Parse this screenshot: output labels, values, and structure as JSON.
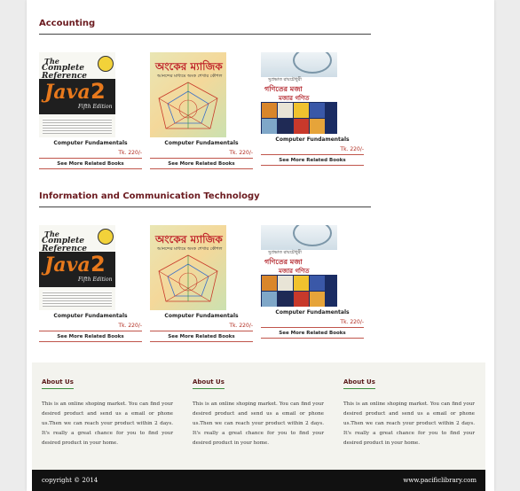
{
  "sections": [
    {
      "title": "Accounting",
      "books": [
        {
          "name": "Computer Fundamentals",
          "price": "Tk. 220/-",
          "more": "See More Related Books",
          "cover": "java"
        },
        {
          "name": "Computer Fundamentals",
          "price": "Tk. 220/-",
          "more": "See More Related Books",
          "cover": "magic"
        },
        {
          "name": "Computer Fundamentals",
          "price": "Tk. 220/-",
          "more": "See More Related Books",
          "cover": "math"
        }
      ]
    },
    {
      "title": "Information and Communication Technology",
      "books": [
        {
          "name": "Computer Fundamentals",
          "price": "Tk. 220/-",
          "more": "See More Related Books",
          "cover": "java"
        },
        {
          "name": "Computer Fundamentals",
          "price": "Tk. 220/-",
          "more": "See More Related Books",
          "cover": "magic"
        },
        {
          "name": "Computer Fundamentals",
          "price": "Tk. 220/-",
          "more": "See More Related Books",
          "cover": "math"
        }
      ]
    }
  ],
  "covers": {
    "java": {
      "line1": "The",
      "line2": "Complete Reference",
      "line3": "Java",
      "line4": "2",
      "line5": "Fifth Edition"
    },
    "magic": {
      "line1": "অংকের ম্যাজিক",
      "line2": "আনন্দের মাধ্যমে অংক শেখার কৌশল"
    },
    "math": {
      "line0": "সুপ্রভাত রায়চৌধুরী",
      "line1": "গণিতের মজা",
      "line2": "মজার গণিত"
    }
  },
  "footer": {
    "columns": [
      {
        "title": "About Us",
        "text": "This is an online shoping market. You can find your desired product and send us a email or phone us.Then we can reach your product within 2 days. It's really a great chance for you to find your desired product in your home."
      },
      {
        "title": "About Us",
        "text": "This is an online shoping market. You can find your desired product and send us a email or phone us.Then we can reach your product within 2 days. It's really a great chance for you to find your desired product in your home."
      },
      {
        "title": "About Us",
        "text": "This is an online shoping market. You can find your desired product and send us a email or phone us.Then we can reach your product within 2 days. It's really a great chance for you to find your desired product in your home."
      }
    ],
    "copyright": "copyright © 2014",
    "site": "www.pacificlibrary.com"
  },
  "colors": {
    "heading": "#6b1a1f",
    "price": "#b02a1e",
    "footer_rule": "#3d8f3f",
    "footer_bar": "#111111"
  }
}
